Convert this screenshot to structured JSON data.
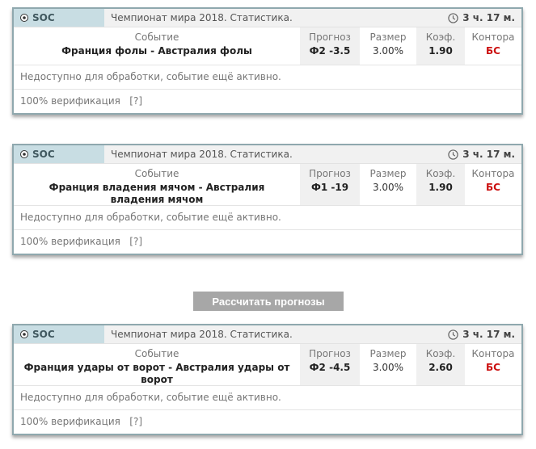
{
  "calc_button": "Рассчитать прогнозы",
  "colors": {
    "sport_bg": "#c8dde3",
    "border": "#8fa8ae",
    "bookmaker": "#cc1111",
    "button": "#a7a7a7"
  },
  "cards": [
    {
      "sport": "SOC",
      "tournament": "Чемпионат мира 2018. Статистика.",
      "time": "3 ч. 17 м.",
      "headers": {
        "event": "Событие",
        "forecast": "Прогноз",
        "size": "Размер",
        "coef": "Коэф.",
        "bookmaker": "Контора"
      },
      "event": "Франция фолы - Австралия фолы",
      "forecast": "Ф2 -3.5",
      "size": "3.00%",
      "coef": "1.90",
      "bookmaker": "БС",
      "status": "Недоступно для обработки, событие ещё активно.",
      "verification": "100% верификация",
      "help": "[?]"
    },
    {
      "sport": "SOC",
      "tournament": "Чемпионат мира 2018. Статистика.",
      "time": "3 ч. 17 м.",
      "headers": {
        "event": "Событие",
        "forecast": "Прогноз",
        "size": "Размер",
        "coef": "Коэф.",
        "bookmaker": "Контора"
      },
      "event": "Франция владения мячом - Австралия владения мячом",
      "forecast": "Ф1 -19",
      "size": "3.00%",
      "coef": "1.90",
      "bookmaker": "БС",
      "status": "Недоступно для обработки, событие ещё активно.",
      "verification": "100% верификация",
      "help": "[?]"
    },
    {
      "sport": "SOC",
      "tournament": "Чемпионат мира 2018. Статистика.",
      "time": "3 ч. 17 м.",
      "headers": {
        "event": "Событие",
        "forecast": "Прогноз",
        "size": "Размер",
        "coef": "Коэф.",
        "bookmaker": "Контора"
      },
      "event": "Франция удары от ворот - Австралия удары от ворот",
      "forecast": "Ф2 -4.5",
      "size": "3.00%",
      "coef": "2.60",
      "bookmaker": "БС",
      "status": "Недоступно для обработки, событие ещё активно.",
      "verification": "100% верификация",
      "help": "[?]"
    }
  ]
}
